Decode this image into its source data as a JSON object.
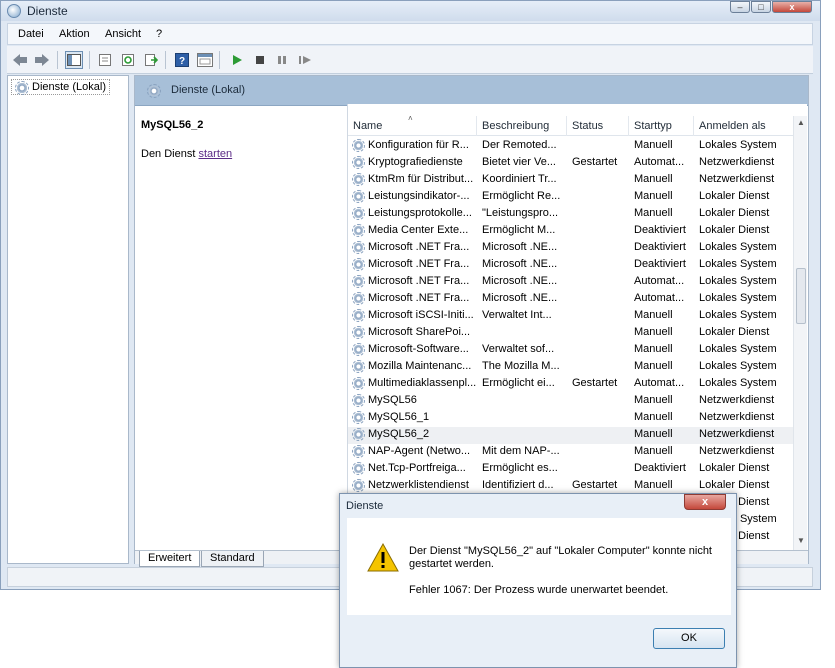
{
  "window": {
    "title": "Dienste",
    "controls": {
      "minimize": "–",
      "maximize": "□",
      "close": "x"
    }
  },
  "menu": [
    "Datei",
    "Aktion",
    "Ansicht",
    "?"
  ],
  "toolbar_icons": [
    "back-arrow-icon",
    "forward-arrow-icon",
    "console-tree-icon",
    "properties-icon",
    "refresh-icon",
    "export-list-icon",
    "help-icon",
    "view-icon",
    "play-icon",
    "stop-icon",
    "pause-icon",
    "restart-icon"
  ],
  "tree": {
    "root_label": "Dienste (Lokal)"
  },
  "content": {
    "header_title": "Dienste (Lokal)",
    "selected_service": "MySQL56_2",
    "action_prefix": "Den Dienst",
    "action_link": "starten"
  },
  "columns": [
    "Name",
    "Beschreibung",
    "Status",
    "Starttyp",
    "Anmelden als"
  ],
  "services": [
    {
      "name": "Konfiguration für R...",
      "desc": "Der Remoted...",
      "status": "",
      "start": "Manuell",
      "logon": "Lokales System"
    },
    {
      "name": "Kryptografiedienste",
      "desc": "Bietet vier Ve...",
      "status": "Gestartet",
      "start": "Automat...",
      "logon": "Netzwerkdienst"
    },
    {
      "name": "KtmRm für Distribut...",
      "desc": "Koordiniert Tr...",
      "status": "",
      "start": "Manuell",
      "logon": "Netzwerkdienst"
    },
    {
      "name": "Leistungsindikator-...",
      "desc": "Ermöglicht Re...",
      "status": "",
      "start": "Manuell",
      "logon": "Lokaler Dienst"
    },
    {
      "name": "Leistungsprotokolle...",
      "desc": "\"Leistungspro...",
      "status": "",
      "start": "Manuell",
      "logon": "Lokaler Dienst"
    },
    {
      "name": "Media Center Exte...",
      "desc": "Ermöglicht M...",
      "status": "",
      "start": "Deaktiviert",
      "logon": "Lokaler Dienst"
    },
    {
      "name": "Microsoft .NET Fra...",
      "desc": "Microsoft .NE...",
      "status": "",
      "start": "Deaktiviert",
      "logon": "Lokales System"
    },
    {
      "name": "Microsoft .NET Fra...",
      "desc": "Microsoft .NE...",
      "status": "",
      "start": "Deaktiviert",
      "logon": "Lokales System"
    },
    {
      "name": "Microsoft .NET Fra...",
      "desc": "Microsoft .NE...",
      "status": "",
      "start": "Automat...",
      "logon": "Lokales System"
    },
    {
      "name": "Microsoft .NET Fra...",
      "desc": "Microsoft .NE...",
      "status": "",
      "start": "Automat...",
      "logon": "Lokales System"
    },
    {
      "name": "Microsoft iSCSI-Initi...",
      "desc": "Verwaltet Int...",
      "status": "",
      "start": "Manuell",
      "logon": "Lokales System"
    },
    {
      "name": "Microsoft SharePoi...",
      "desc": "",
      "status": "",
      "start": "Manuell",
      "logon": "Lokaler Dienst"
    },
    {
      "name": "Microsoft-Software...",
      "desc": "Verwaltet sof...",
      "status": "",
      "start": "Manuell",
      "logon": "Lokales System"
    },
    {
      "name": "Mozilla Maintenanc...",
      "desc": "The Mozilla M...",
      "status": "",
      "start": "Manuell",
      "logon": "Lokales System"
    },
    {
      "name": "Multimediaklassenpl...",
      "desc": "Ermöglicht ei...",
      "status": "Gestartet",
      "start": "Automat...",
      "logon": "Lokales System"
    },
    {
      "name": "MySQL56",
      "desc": "",
      "status": "",
      "start": "Manuell",
      "logon": "Netzwerkdienst"
    },
    {
      "name": "MySQL56_1",
      "desc": "",
      "status": "",
      "start": "Manuell",
      "logon": "Netzwerkdienst"
    },
    {
      "name": "MySQL56_2",
      "desc": "",
      "status": "",
      "start": "Manuell",
      "logon": "Netzwerkdienst",
      "selected": true
    },
    {
      "name": "NAP-Agent (Netwo...",
      "desc": "Mit dem NAP-...",
      "status": "",
      "start": "Manuell",
      "logon": "Netzwerkdienst"
    },
    {
      "name": "Net.Tcp-Portfreiga...",
      "desc": "Ermöglicht es...",
      "status": "",
      "start": "Deaktiviert",
      "logon": "Lokaler Dienst"
    },
    {
      "name": "Netzwerklistendienst",
      "desc": "Identifiziert d...",
      "status": "Gestartet",
      "start": "Manuell",
      "logon": "Lokaler Dienst"
    },
    {
      "name": "",
      "desc": "",
      "status": "",
      "start": "",
      "logon": "Lokaler Dienst"
    },
    {
      "name": "",
      "desc": "",
      "status": "",
      "start": "",
      "logon": "Lokales System"
    },
    {
      "name": "",
      "desc": "",
      "status": "",
      "start": "",
      "logon": "Lokaler Dienst"
    }
  ],
  "tabs": [
    "Erweitert",
    "Standard"
  ],
  "dialog": {
    "title": "Dienste",
    "close": "x",
    "message": "Der Dienst \"MySQL56_2\" auf \"Lokaler Computer\" konnte nicht gestartet werden.",
    "error": "Fehler 1067: Der Prozess wurde unerwartet beendet.",
    "ok": "OK"
  }
}
